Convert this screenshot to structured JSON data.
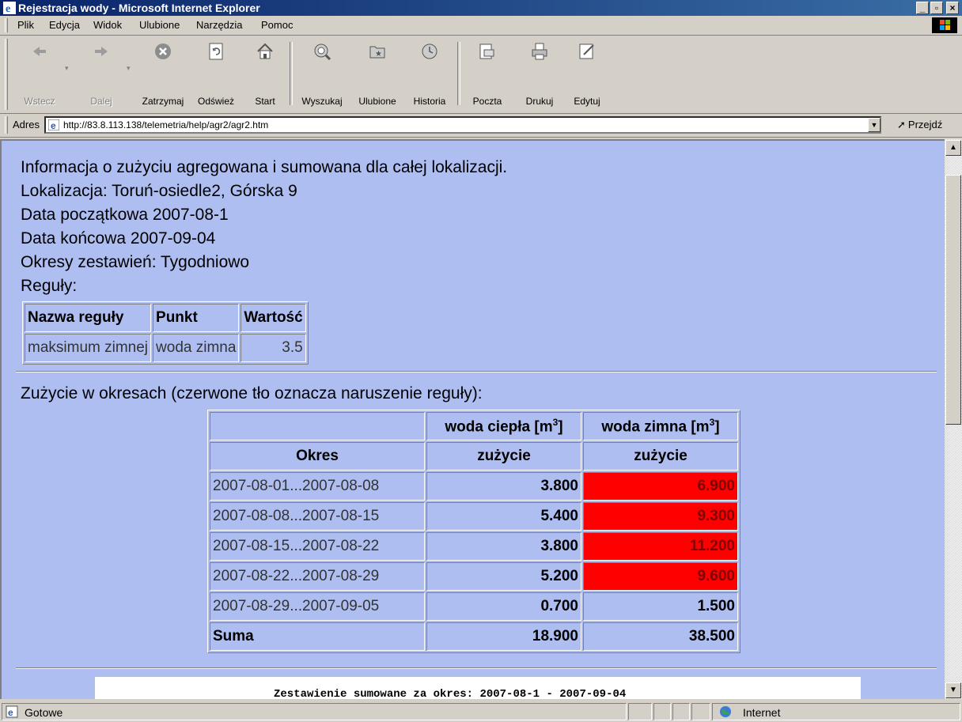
{
  "window": {
    "title": "Rejestracja wody - Microsoft Internet Explorer",
    "controls": {
      "minimize": "_",
      "maximize": "▫",
      "close": "×"
    }
  },
  "menu": {
    "items": [
      {
        "label": "Plik"
      },
      {
        "label": "Edycja"
      },
      {
        "label": "Widok"
      },
      {
        "label": "Ulubione"
      },
      {
        "label": "Narzędzia"
      },
      {
        "label": "Pomoc"
      }
    ]
  },
  "toolbar": {
    "buttons": [
      {
        "label": "Wstecz",
        "icon": "back-arrow-icon",
        "enabled": false
      },
      {
        "label": "Dalej",
        "icon": "forward-arrow-icon",
        "enabled": false
      },
      {
        "label": "Zatrzymaj",
        "icon": "stop-icon",
        "enabled": true
      },
      {
        "label": "Odśwież",
        "icon": "refresh-icon",
        "enabled": true
      },
      {
        "label": "Start",
        "icon": "home-icon",
        "enabled": true
      },
      {
        "label": "Wyszukaj",
        "icon": "search-icon",
        "enabled": true
      },
      {
        "label": "Ulubione",
        "icon": "favorites-icon",
        "enabled": true
      },
      {
        "label": "Historia",
        "icon": "history-icon",
        "enabled": true
      },
      {
        "label": "Poczta",
        "icon": "mail-icon",
        "enabled": true
      },
      {
        "label": "Drukuj",
        "icon": "print-icon",
        "enabled": true
      },
      {
        "label": "Edytuj",
        "icon": "edit-icon",
        "enabled": true
      }
    ]
  },
  "address": {
    "label": "Adres",
    "url": "http://83.8.113.138/telemetria/help/agr2/agr2.htm",
    "go_label": "Przejdź"
  },
  "page": {
    "info": [
      "Informacja o zużyciu agregowana i sumowana dla całej lokalizacji.",
      "Lokalizacja: Toruń-osiedle2, Górska 9",
      "Data początkowa 2007-08-1",
      "Data końcowa 2007-09-04",
      "Okresy zestawień: Tygodniowo",
      "Reguły:"
    ],
    "rules_table": {
      "headers": [
        "Nazwa reguły",
        "Punkt",
        "Wartość"
      ],
      "rows": [
        [
          "maksimum zimnej",
          "woda zimna",
          "3.5"
        ]
      ]
    },
    "usage_title": "Zużycie w okresach (czerwone tło oznacza naruszenie reguły):",
    "usage_table": {
      "col_hot": "woda ciepła [m",
      "col_cold": "woda zimna [m",
      "unit_sup": "3",
      "unit_close": "]",
      "period_header": "Okres",
      "sub_header": "zużycie",
      "rows": [
        {
          "period": "2007-08-01...2007-08-08",
          "hot": "3.800",
          "cold": "6.900",
          "violation": true
        },
        {
          "period": "2007-08-08...2007-08-15",
          "hot": "5.400",
          "cold": "9.300",
          "violation": true
        },
        {
          "period": "2007-08-15...2007-08-22",
          "hot": "3.800",
          "cold": "11.200",
          "violation": true
        },
        {
          "period": "2007-08-22...2007-08-29",
          "hot": "5.200",
          "cold": "9.600",
          "violation": true
        },
        {
          "period": "2007-08-29...2007-09-05",
          "hot": "0.700",
          "cold": "1.500",
          "violation": false
        }
      ],
      "sum_label": "Suma",
      "sum_hot": "18.900",
      "sum_cold": "38.500"
    },
    "summary_caption": "Zestawienie sumowane za okres: 2007-08-1 - 2007-09-04"
  },
  "status": {
    "text": "Gotowe",
    "zone": "Internet"
  },
  "colors": {
    "page_background": "#aebef0",
    "violation": "#ff0000",
    "titlebar": "#0a246a"
  }
}
